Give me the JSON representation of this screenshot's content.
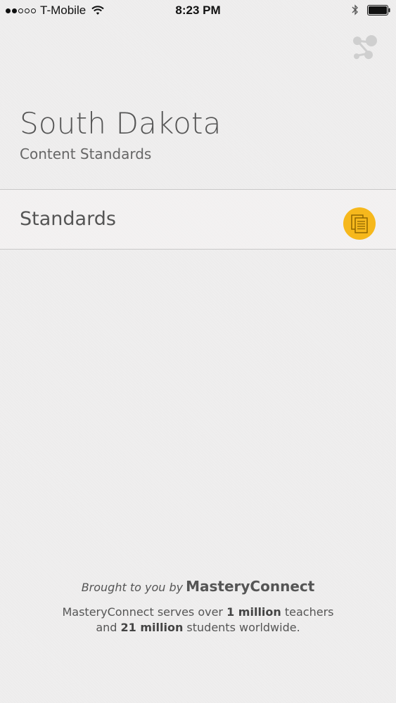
{
  "status_bar": {
    "carrier": "T-Mobile",
    "time": "8:23 PM",
    "signal_bars_filled": 2,
    "signal_bars_total": 5
  },
  "header": {
    "share_icon": "share-icon"
  },
  "title": {
    "state": "South Dakota",
    "subtitle": "Content Standards"
  },
  "list": {
    "items": [
      {
        "label": "Standards",
        "icon": "documents-icon",
        "icon_color": "#f6b81c"
      }
    ]
  },
  "footer": {
    "brought_prefix": "Brought to you by",
    "brand": "MasteryConnect",
    "tagline_part1": "MasteryConnect serves over ",
    "tagline_bold1": "1 million",
    "tagline_part2": " teachers",
    "tagline_part3": "and ",
    "tagline_bold2": "21 million",
    "tagline_part4": " students worldwide."
  },
  "colors": {
    "background": "#efeeee",
    "accent": "#f6b81c",
    "text": "#555555"
  }
}
